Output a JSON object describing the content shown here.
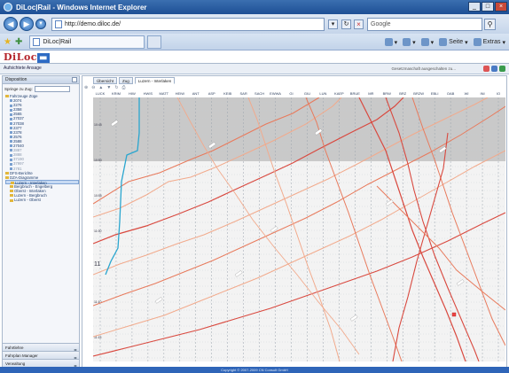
{
  "browser": {
    "window_title": "DiLoc|Rail - Windows Internet Explorer",
    "url": "http://demo.diloc.de/",
    "search_placeholder": "Google",
    "tab_title": "DiLoc|Rail",
    "toolbar": {
      "page": "Seite",
      "extras": "Extras"
    }
  },
  "app": {
    "logo": "DiLoc",
    "user_link": "Aufsichtete Ansage",
    "logged_in_text": "Gesetzmaschaft ausgeschalten zu..."
  },
  "sidebar": {
    "title": "Disposition",
    "jump_label": "Springe zu Zug:",
    "tree_root": "Fahrzeuge Züge",
    "trains": [
      "2074",
      "2276",
      "2358",
      "2565",
      "27037",
      "27038",
      "2377",
      "2378",
      "2576",
      "2588",
      "27040",
      "2887",
      "2888",
      "37190",
      "37997",
      "2781"
    ],
    "folders": [
      "DFS-Berichte",
      "DZA-Diagramme"
    ],
    "diagrams": [
      "Luzern - Interlaken",
      "Bergbruch - Engelberg",
      "Oberst - Interlaken",
      "Luzern - Bergbruch",
      "Luzern - Oberst"
    ],
    "bottom_items": [
      "Fahrtlehre",
      "Fahrplan Manager",
      "Verwaltung"
    ]
  },
  "main": {
    "tabs": [
      "Übersicht",
      "Zug",
      "Luzern - Interlaken"
    ],
    "stations": [
      "LUCK",
      "KRIM",
      "HIW",
      "HWIS",
      "MATT",
      "HEIW",
      "ANT",
      "ASP",
      "KEIB",
      "SAR",
      "SACH",
      "EWWA",
      "GI",
      "GIU",
      "LUN",
      "KAEP",
      "BRUE",
      "MR",
      "BRW",
      "BRZ",
      "BRZW",
      "EBLI",
      "OAB",
      "WI",
      "INI",
      "IO"
    ],
    "hour_label": "11",
    "diagram_label_time": "11"
  },
  "footer": "Copyright © 2007-2009 CN Consult GmbH",
  "colors": {
    "train_dark": "#d9493f",
    "train_mid": "#e87a5c",
    "train_light": "#f2aa8c",
    "train_selected": "#2aa6cf",
    "past_shade": "#c9c9c9"
  }
}
